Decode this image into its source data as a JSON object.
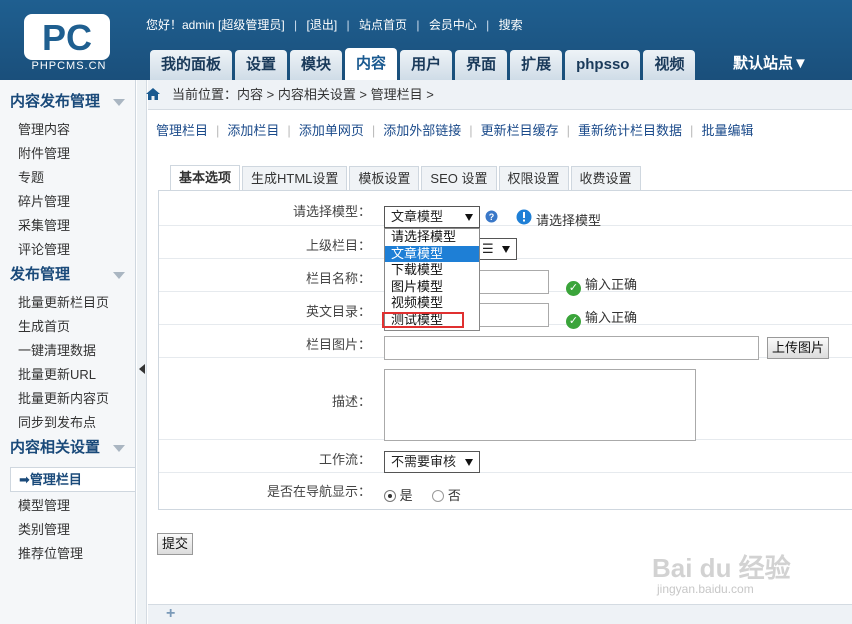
{
  "header": {
    "logo_text": "PHPCMS.CN",
    "greeting": "您好！admin [超级管理员]",
    "links": [
      "[退出]",
      "站点首页",
      "会员中心",
      "搜索"
    ],
    "tabs": [
      "我的面板",
      "设置",
      "模块",
      "内容",
      "用户",
      "界面",
      "扩展",
      "phpsso",
      "视频"
    ],
    "active_tab": "内容",
    "site_select": "默认站点▼"
  },
  "sidebar": {
    "groups": [
      {
        "title": "内容发布管理",
        "items": [
          "管理内容",
          "附件管理",
          "专题",
          "碎片管理",
          "采集管理",
          "评论管理"
        ]
      },
      {
        "title": "发布管理",
        "items": [
          "批量更新栏目页",
          "生成首页",
          "一键清理数据",
          "批量更新URL",
          "批量更新内容页",
          "同步到发布点"
        ]
      },
      {
        "title": "内容相关设置",
        "items": [
          "➡管理栏目",
          "模型管理",
          "类别管理",
          "推荐位管理"
        ]
      }
    ]
  },
  "breadcrumb": "当前位置：内容 > 内容相关设置 > 管理栏目 >",
  "subnav": [
    "管理栏目",
    "添加栏目",
    "添加单网页",
    "添加外部链接",
    "更新栏目缓存",
    "重新统计栏目数据",
    "批量编辑"
  ],
  "form_tabs": [
    "基本选项",
    "生成HTML设置",
    "模板设置",
    "SEO 设置",
    "权限设置",
    "收费设置"
  ],
  "form": {
    "model_label": "请选择模型：",
    "model_value": "文章模型",
    "model_hint": "请选择模型",
    "parent_label": "上级栏目：",
    "parent_value": "☰",
    "name_label": "栏目名称：",
    "name_ok": "输入正确",
    "dir_label": "英文目录：",
    "dir_ok": "输入正确",
    "image_label": "栏目图片：",
    "upload_button": "上传图片",
    "desc_label": "描述：",
    "workflow_label": "工作流：",
    "workflow_value": "不需要审核",
    "nav_label": "是否在导航显示：",
    "nav_yes": "是",
    "nav_no": "否",
    "submit": "提交"
  },
  "dropdown_options": [
    "请选择模型",
    "文章模型",
    "下载模型",
    "图片模型",
    "视频模型",
    "测试模型"
  ],
  "dropdown_selected_index": 1,
  "watermark": "Bai du 经验",
  "watermark_url": "jingyan.baidu.com",
  "footer_plus": "+"
}
